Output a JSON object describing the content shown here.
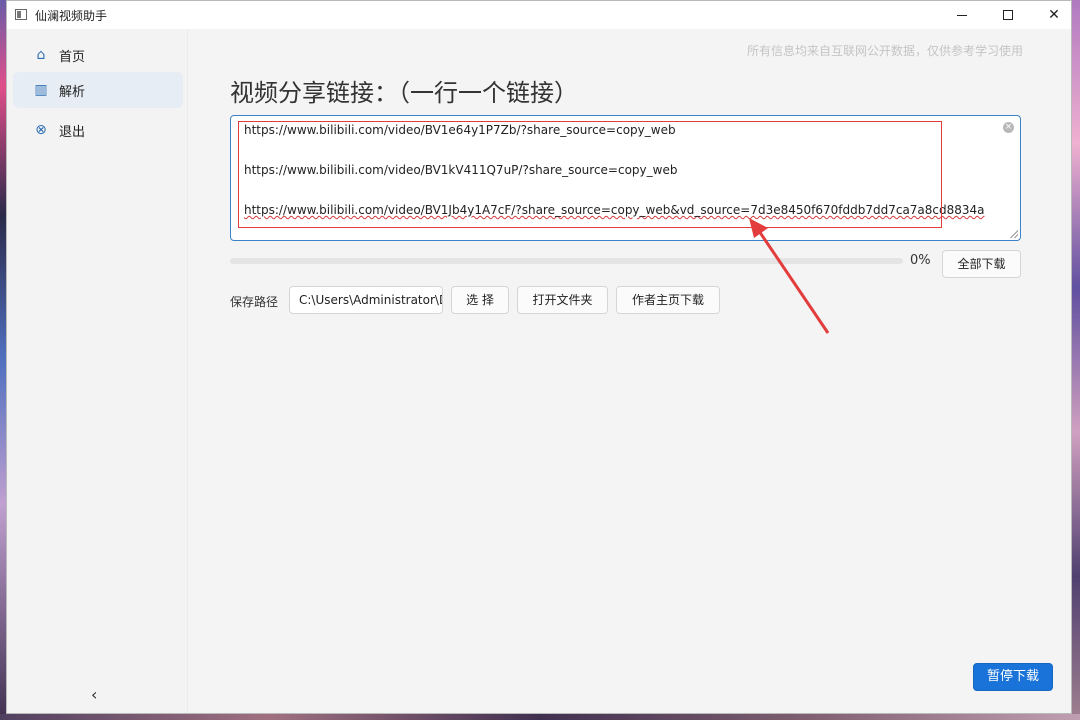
{
  "window": {
    "title": "仙澜视频助手",
    "minimize_glyph": "",
    "maximize_glyph": "",
    "close_glyph": "✕"
  },
  "sidebar": {
    "items": [
      {
        "label": "首页",
        "icon": "bank-icon",
        "glyph": "⌂",
        "active": false
      },
      {
        "label": "解析",
        "icon": "panel-icon",
        "glyph": "▥",
        "active": true
      },
      {
        "label": "退出",
        "icon": "close-circle-icon",
        "glyph": "⊗",
        "active": false
      }
    ],
    "collapse_glyph": "‹"
  },
  "main": {
    "disclaimer": "所有信息均来自互联网公开数据，仅供参考学习使用",
    "heading": "视频分享链接：（一行一个链接）",
    "links": [
      "https://www.bilibili.com/video/BV1e64y1P7Zb/?share_source=copy_web",
      "https://www.bilibili.com/video/BV1kV411Q7uP/?share_source=copy_web",
      "https://www.bilibili.com/video/BV1Jb4y1A7cF/?share_source=copy_web&vd_source=7d3e8450f670fddb7dd7ca7a8cd8834a"
    ],
    "progress": {
      "value": 0,
      "text": "0%"
    },
    "download_all_label": "全部下载",
    "save_path_label": "保存路径",
    "save_path_value": "C:\\Users\\Administrator\\Desktop",
    "choose_label": "选 择",
    "open_folder_label": "打开文件夹",
    "author_download_label": "作者主页下载",
    "pause_label": "暂停下载"
  },
  "colors": {
    "accent": "#1a73d9",
    "annotation": "#e23c3c"
  }
}
